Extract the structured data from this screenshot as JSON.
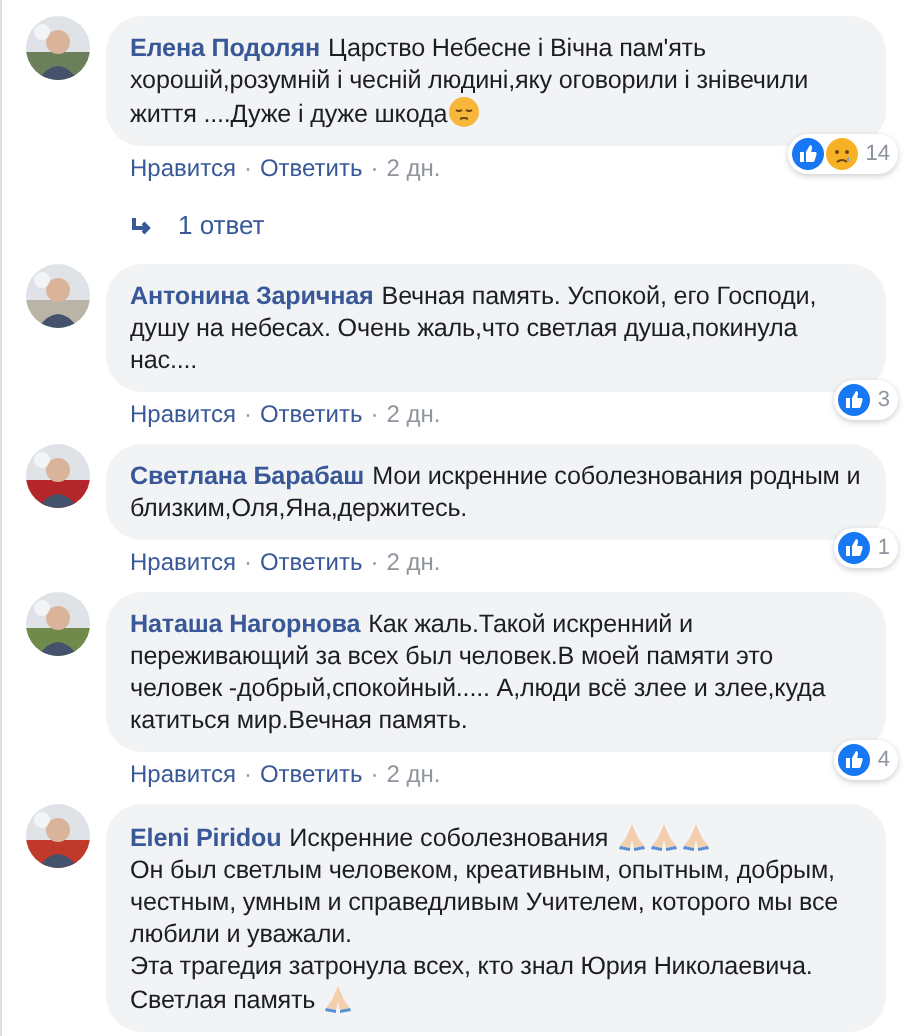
{
  "comments": [
    {
      "author": "Елена Подолян",
      "body": [
        {
          "kind": "text",
          "text": "Царство Небесне і Вічна пам'ять хорошій,розумній і чесній людині,яку оговорили і знівечили життя ....Дуже і дуже шкода"
        },
        {
          "kind": "face"
        }
      ],
      "reactions": {
        "icons": [
          {
            "kind": "like"
          },
          {
            "kind": "sad"
          }
        ],
        "count": "14"
      },
      "actions": {
        "like": "Нравится",
        "separator_1": "·",
        "reply": "Ответить",
        "separator_2": "·",
        "time": "2 дн."
      },
      "replies": "1 ответ",
      "avatar": {
        "kind": "picture"
      }
    },
    {
      "author": "Антонина Заричная",
      "body": [
        {
          "kind": "text",
          "text": "Вечная память. Успокой, его Господи, душу на небесах. Очень жаль,что светлая душа,покинула нас...."
        }
      ],
      "reactions": {
        "icons": [
          {
            "kind": "like"
          }
        ],
        "count": "3"
      },
      "actions": {
        "like": "Нравится",
        "separator_1": "·",
        "reply": "Ответить",
        "separator_2": "·",
        "time": "2 дн."
      },
      "avatar": {
        "kind": "picture"
      }
    },
    {
      "author": "Светлана Барабаш",
      "body": [
        {
          "kind": "text",
          "text": "Мои искренние соболезнования родным и близким,Оля,Яна,держитесь."
        }
      ],
      "reactions": {
        "icons": [
          {
            "kind": "like"
          }
        ],
        "count": "1"
      },
      "actions": {
        "like": "Нравится",
        "separator_1": "·",
        "reply": "Ответить",
        "separator_2": "·",
        "time": "2 дн."
      },
      "avatar": {
        "kind": "picture"
      }
    },
    {
      "author": "Наташа Нагорнова",
      "body": [
        {
          "kind": "text",
          "text": "Как жаль.Такой искренний и переживающий за всех был человек.В моей памяти это человек -добрый,спокойный..... А,люди всё злее и злее,куда катиться мир.Вечная память."
        }
      ],
      "reactions": {
        "icons": [
          {
            "kind": "like"
          }
        ],
        "count": "4"
      },
      "actions": {
        "like": "Нравится",
        "separator_1": "·",
        "reply": "Ответить",
        "separator_2": "·",
        "time": "2 дн."
      },
      "avatar": {
        "kind": "picture"
      }
    },
    {
      "author": "Eleni Piridou",
      "body": [
        {
          "kind": "text",
          "text": "Искренние соболезнования "
        },
        {
          "kind": "hands"
        },
        {
          "kind": "hands"
        },
        {
          "kind": "hands"
        },
        {
          "kind": "text",
          "text": "\nОн был светлым человеком, креативным, опытным, добрым, честным, умным и справедливым Учителем, которого мы все любили и уважали.\nЭта трагедия затронула всех, кто знал Юрия Николаевича.\nСветлая память "
        },
        {
          "kind": "hands"
        }
      ],
      "avatar": {
        "kind": "picture"
      }
    }
  ]
}
